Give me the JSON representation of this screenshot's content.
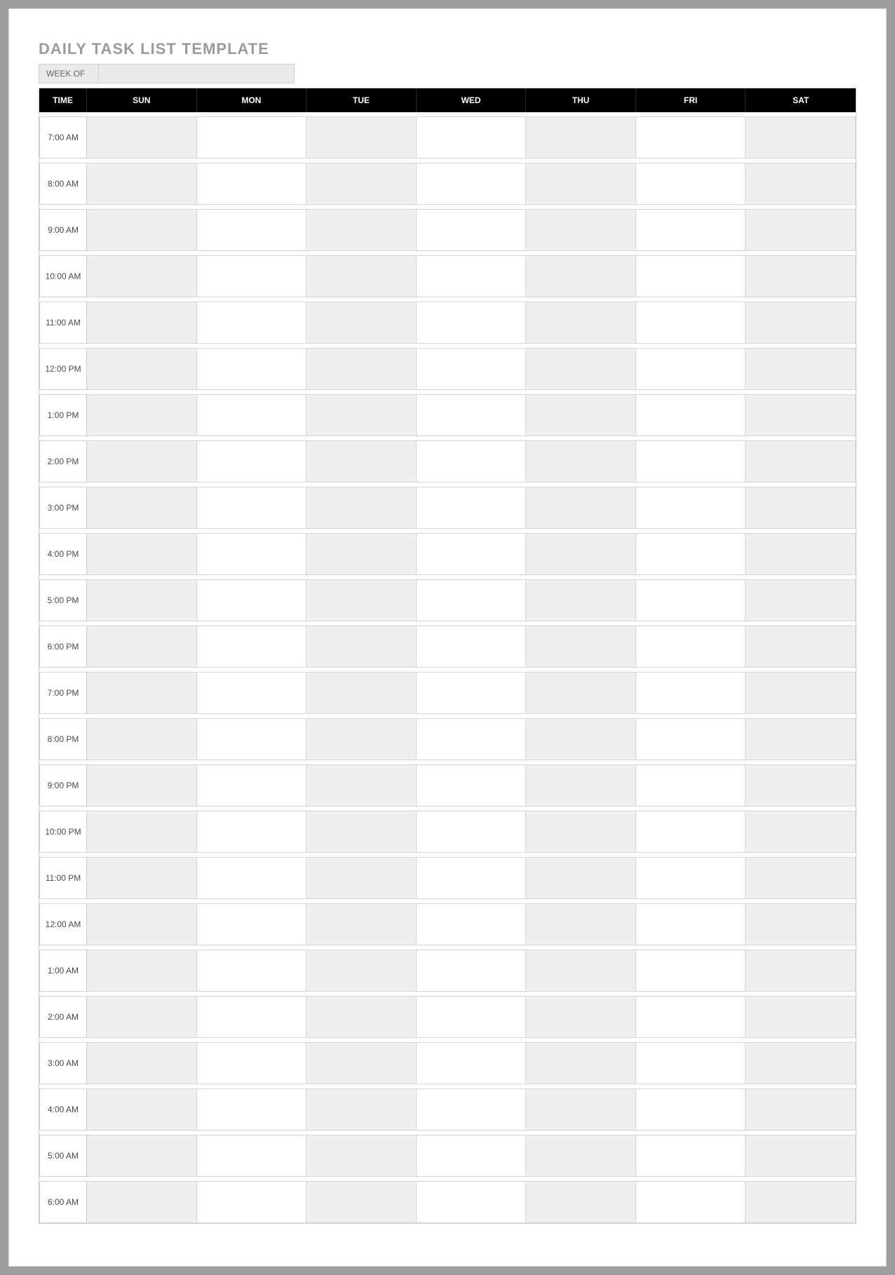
{
  "title": "DAILY TASK LIST TEMPLATE",
  "week_of_label": "WEEK OF",
  "week_of_value": "",
  "headers": {
    "time": "TIME",
    "days": [
      "SUN",
      "MON",
      "TUE",
      "WED",
      "THU",
      "FRI",
      "SAT"
    ]
  },
  "shaded_columns": [
    0,
    2,
    4,
    6
  ],
  "times": [
    "7:00 AM",
    "8:00 AM",
    "9:00 AM",
    "10:00 AM",
    "11:00 AM",
    "12:00 PM",
    "1:00 PM",
    "2:00 PM",
    "3:00 PM",
    "4:00 PM",
    "5:00 PM",
    "6:00 PM",
    "7:00 PM",
    "8:00 PM",
    "9:00 PM",
    "10:00 PM",
    "11:00 PM",
    "12:00 AM",
    "1:00 AM",
    "2:00 AM",
    "3:00 AM",
    "4:00 AM",
    "5:00 AM",
    "6:00 AM"
  ],
  "cells": {}
}
